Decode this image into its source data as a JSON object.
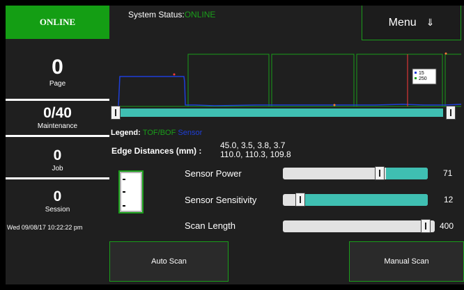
{
  "sidebar": {
    "status": "ONLINE",
    "stats": [
      {
        "value": "0",
        "label": "Page"
      },
      {
        "value": "0/40",
        "label": "Maintenance"
      },
      {
        "value": "0",
        "label": "Job"
      },
      {
        "value": "0",
        "label": "Session"
      }
    ],
    "datetime": "Wed 09/08/17 10:22:22 pm"
  },
  "header": {
    "system_status_label": "System Status:",
    "system_status_value": "ONLINE",
    "menu_label": "Menu",
    "menu_icon": "arrow-down-icon"
  },
  "plot": {
    "legend_values": [
      "15",
      "250"
    ],
    "colors": {
      "tof": "#1a9e1a",
      "sensor": "#1f3fd8",
      "marker": "#ff3a3a"
    }
  },
  "legend": {
    "label": "Legend:",
    "tof": "TOF/BOF",
    "sensor": "Sensor"
  },
  "edges": {
    "label": "Edge Distances (mm) :",
    "line1": "45.0, 3.5, 3.8, 3.7",
    "line2": "110.0, 110.3, 109.8"
  },
  "controls": [
    {
      "label": "Sensor Power",
      "value": "71",
      "level": 0.71
    },
    {
      "label": "Sensor Sensitivity",
      "value": "12",
      "level": 0.12
    },
    {
      "label": "Scan Length",
      "value": "400",
      "level": 1.0
    }
  ],
  "buttons": {
    "auto_scan": "Auto Scan",
    "manual_scan": "Manual Scan"
  }
}
